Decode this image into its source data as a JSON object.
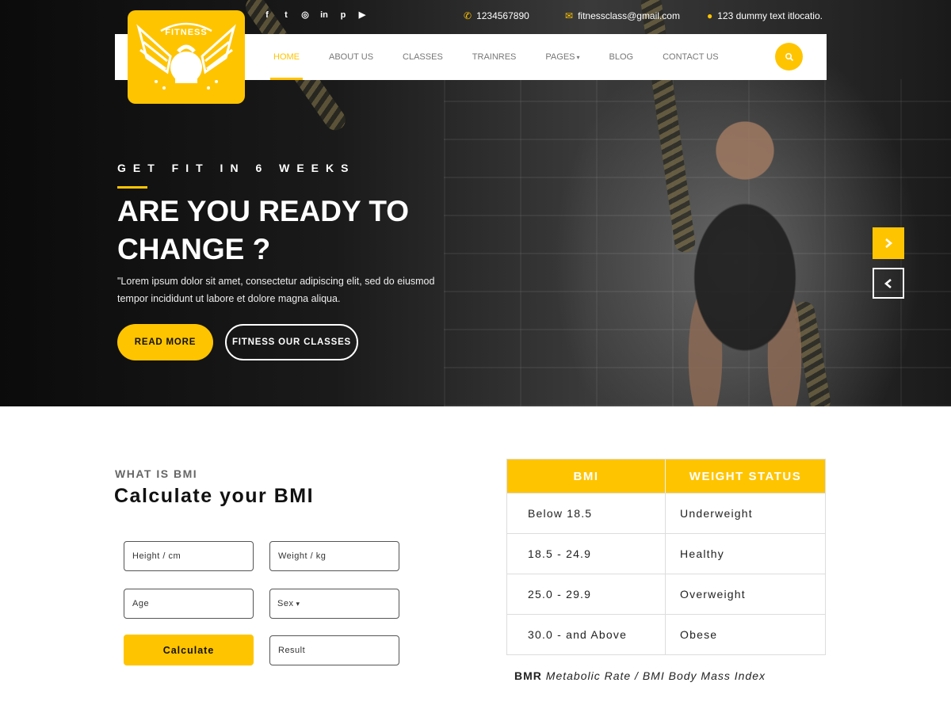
{
  "topbar": {
    "social_icons": [
      "facebook-icon",
      "twitter-icon",
      "instagram-icon",
      "linkedin-icon",
      "pinterest-icon",
      "youtube-icon"
    ],
    "phone": "1234567890",
    "email": "fitnessclass@gmail.com",
    "address": "123 dummy text itlocatio."
  },
  "logo": {
    "text": "FITNESS"
  },
  "nav": {
    "items": [
      {
        "label": "HOME",
        "active": true
      },
      {
        "label": "ABOUT US"
      },
      {
        "label": "CLASSES"
      },
      {
        "label": "TRAINRES"
      },
      {
        "label": "PAGES",
        "has_dropdown": true
      },
      {
        "label": "BLOG"
      },
      {
        "label": "CONTACT US"
      }
    ]
  },
  "hero": {
    "kicker": "GET FIT IN 6 WEEKS",
    "title": "ARE YOU READY TO CHANGE ?",
    "description": "\"Lorem ipsum dolor sit amet, consectetur adipiscing elit, sed do eiusmod tempor incididunt ut labore et dolore magna aliqua.",
    "read_more": "READ MORE",
    "classes_button": "FITNESS OUR CLASSES"
  },
  "bmi": {
    "kicker": "WHAT IS BMI",
    "title": "Calculate your BMI",
    "height_placeholder": "Height / cm",
    "weight_placeholder": "Weight / kg",
    "age_placeholder": "Age",
    "sex_label": "Sex",
    "calculate": "Calculate",
    "result_placeholder": "Result",
    "table": {
      "headers": [
        "BMI",
        "WEIGHT STATUS"
      ],
      "rows": [
        [
          "Below 18.5",
          "Underweight"
        ],
        [
          "18.5 - 24.9",
          "Healthy"
        ],
        [
          "25.0 - 29.9",
          "Overweight"
        ],
        [
          "30.0 - and Above",
          "Obese"
        ]
      ]
    },
    "note_bold": "BMR",
    "note_italic": "Metabolic Rate / BMI Body Mass Index"
  },
  "colors": {
    "accent": "#ffc400"
  }
}
